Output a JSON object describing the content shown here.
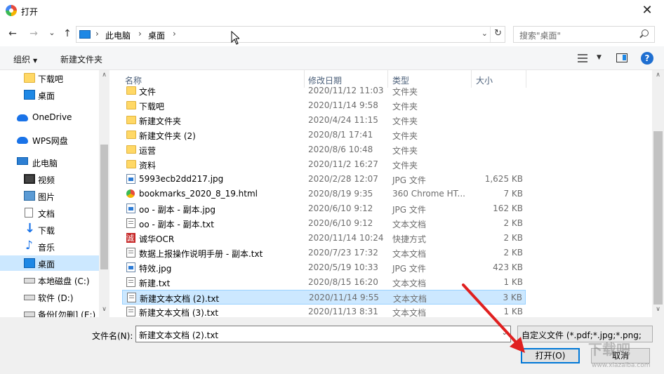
{
  "window": {
    "title": "打开",
    "close_glyph": "✕"
  },
  "nav_buttons": {
    "back": "←",
    "forward": "→",
    "recent": "⌄",
    "up": "↑"
  },
  "address": {
    "crumbs": [
      "此电脑",
      "桌面"
    ],
    "separator": "›",
    "dropdown": "⌄",
    "refresh": "↻"
  },
  "search": {
    "placeholder": "搜索\"桌面\""
  },
  "toolbar": {
    "organize": "组织",
    "organize_caret": "▼",
    "new_folder": "新建文件夹",
    "view_caret": "▼",
    "help": "?"
  },
  "nav_pane": {
    "items": [
      {
        "label": "下载吧",
        "icon": "folder-icon"
      },
      {
        "label": "桌面",
        "icon": "desktop-icon"
      },
      {
        "label": "OneDrive",
        "icon": "onedrive-icon"
      },
      {
        "label": "WPS网盘",
        "icon": "wps-cloud-icon"
      },
      {
        "label": "此电脑",
        "icon": "computer-icon"
      },
      {
        "label": "视频",
        "icon": "video-icon"
      },
      {
        "label": "图片",
        "icon": "pictures-icon"
      },
      {
        "label": "文档",
        "icon": "documents-icon"
      },
      {
        "label": "下载",
        "icon": "download-icon"
      },
      {
        "label": "音乐",
        "icon": "music-icon"
      },
      {
        "label": "桌面",
        "icon": "desktop-icon",
        "selected": true
      },
      {
        "label": "本地磁盘 (C:)",
        "icon": "drive-icon"
      },
      {
        "label": "软件 (D:)",
        "icon": "drive-icon"
      },
      {
        "label": "备份[勿删] (E:)",
        "icon": "drive-icon"
      }
    ]
  },
  "columns": {
    "name": "名称",
    "date": "修改日期",
    "type": "类型",
    "size": "大小"
  },
  "files": [
    {
      "name": "文件",
      "date": "2020/11/12 11:03",
      "type": "文件夹",
      "size": "",
      "icon": "folder"
    },
    {
      "name": "下载吧",
      "date": "2020/11/14 9:58",
      "type": "文件夹",
      "size": "",
      "icon": "folder"
    },
    {
      "name": "新建文件夹",
      "date": "2020/4/24 11:15",
      "type": "文件夹",
      "size": "",
      "icon": "folder"
    },
    {
      "name": "新建文件夹 (2)",
      "date": "2020/8/1 17:41",
      "type": "文件夹",
      "size": "",
      "icon": "folder"
    },
    {
      "name": "运营",
      "date": "2020/8/6 10:48",
      "type": "文件夹",
      "size": "",
      "icon": "folder"
    },
    {
      "name": "资料",
      "date": "2020/11/2 16:27",
      "type": "文件夹",
      "size": "",
      "icon": "folder"
    },
    {
      "name": "5993ecb2dd217.jpg",
      "date": "2020/2/28 12:07",
      "type": "JPG 文件",
      "size": "1,625 KB",
      "icon": "jpg"
    },
    {
      "name": "bookmarks_2020_8_19.html",
      "date": "2020/8/19 9:35",
      "type": "360 Chrome HT...",
      "size": "7 KB",
      "icon": "html"
    },
    {
      "name": "oo - 副本 - 副本.jpg",
      "date": "2020/6/10 9:12",
      "type": "JPG 文件",
      "size": "162 KB",
      "icon": "jpg"
    },
    {
      "name": "oo - 副本 - 副本.txt",
      "date": "2020/6/10 9:12",
      "type": "文本文档",
      "size": "2 KB",
      "icon": "txt"
    },
    {
      "name": "诚华OCR",
      "date": "2020/11/14 10:24",
      "type": "快捷方式",
      "size": "2 KB",
      "icon": "lnk"
    },
    {
      "name": "数据上报操作说明手册 - 副本.txt",
      "date": "2020/7/23 17:32",
      "type": "文本文档",
      "size": "2 KB",
      "icon": "txt"
    },
    {
      "name": "特效.jpg",
      "date": "2020/5/19 10:33",
      "type": "JPG 文件",
      "size": "423 KB",
      "icon": "jpg"
    },
    {
      "name": "新建.txt",
      "date": "2020/8/15 16:20",
      "type": "文本文档",
      "size": "1 KB",
      "icon": "txt"
    },
    {
      "name": "新建文本文档 (2).txt",
      "date": "2020/11/14 9:55",
      "type": "文本文档",
      "size": "3 KB",
      "icon": "txt",
      "selected": true
    },
    {
      "name": "新建文本文档 (3).txt",
      "date": "2020/11/13 8:31",
      "type": "文本文档",
      "size": "1 KB",
      "icon": "txt"
    }
  ],
  "footer": {
    "filename_label": "文件名(N):",
    "filename_value": "新建文本文档 (2).txt",
    "filename_dropdown": "⌄",
    "filter_value": "自定义文件 (*.pdf;*.jpg;*.png;",
    "open_label": "打开(O)",
    "cancel_label": "取消"
  },
  "scroll": {
    "up": "∧",
    "down": "∨"
  },
  "watermark": {
    "text": "下载吧",
    "url": "www.xiazaiba.com"
  },
  "colors": {
    "selection": "#cce8ff",
    "accent": "#0078d7",
    "annotation_arrow": "#e02020"
  }
}
